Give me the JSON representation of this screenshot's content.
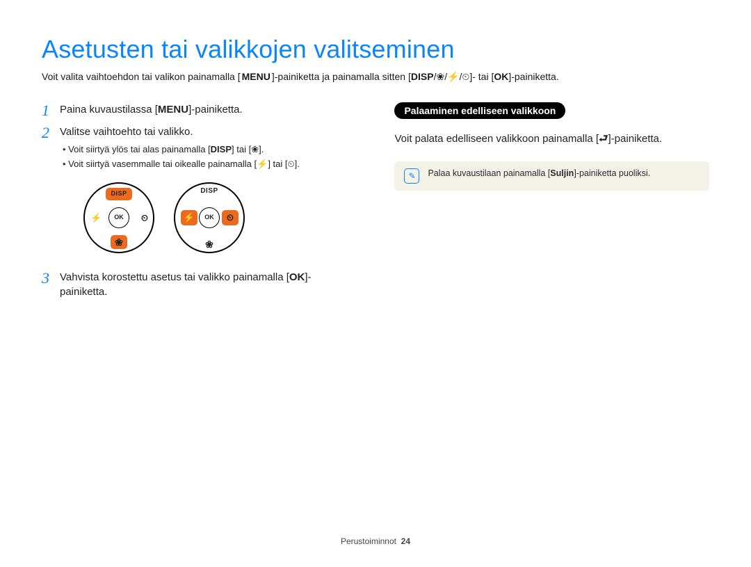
{
  "title": "Asetusten tai valikkojen valitseminen",
  "intro": {
    "pre": "Voit valita vaihtoehdon tai valikon painamalla [",
    "menu": "MENU",
    "mid1": "]-painiketta ja painamalla sitten [",
    "disp": "DISP",
    "slash1": "/",
    "macro": "❀",
    "slash2": "/",
    "flash": "⚡",
    "slash3": "/",
    "timer": "⏲",
    "mid2": "]- tai [",
    "ok": "OK",
    "post": "]-painiketta."
  },
  "steps": [
    {
      "num": "1",
      "pre": "Paina kuvaustilassa [",
      "btn": "MENU",
      "post": "]-painiketta."
    },
    {
      "num": "2",
      "text": "Valitse vaihtoehto tai valikko.",
      "bullets": [
        {
          "pre": "Voit siirtyä ylös tai alas painamalla [",
          "b1": "DISP",
          "mid": "] tai [",
          "b2": "❀",
          "post": "]."
        },
        {
          "pre": "Voit siirtyä vasemmalle tai oikealle painamalla [",
          "b1": "⚡",
          "mid": "] tai [",
          "b2": "⏲",
          "post": "]."
        }
      ]
    },
    {
      "num": "3",
      "pre": "Vahvista korostettu asetus tai valikko painamalla [",
      "btn": "OK",
      "post": "]-painiketta."
    }
  ],
  "dial": {
    "top": "DISP",
    "bottom": "❀",
    "left": "⚡",
    "right": "⏲",
    "center": "OK"
  },
  "right": {
    "pill": "Palaaminen edelliseen valikkoon",
    "para_pre": "Voit palata edelliseen valikkoon painamalla [",
    "para_icon": "⮐",
    "para_post": "]-painiketta.",
    "note_pre": "Palaa kuvaustilaan painamalla [",
    "note_bold": "Suljin",
    "note_post": "]-painiketta puoliksi."
  },
  "footer": {
    "label": "Perustoiminnot",
    "page": "24"
  }
}
